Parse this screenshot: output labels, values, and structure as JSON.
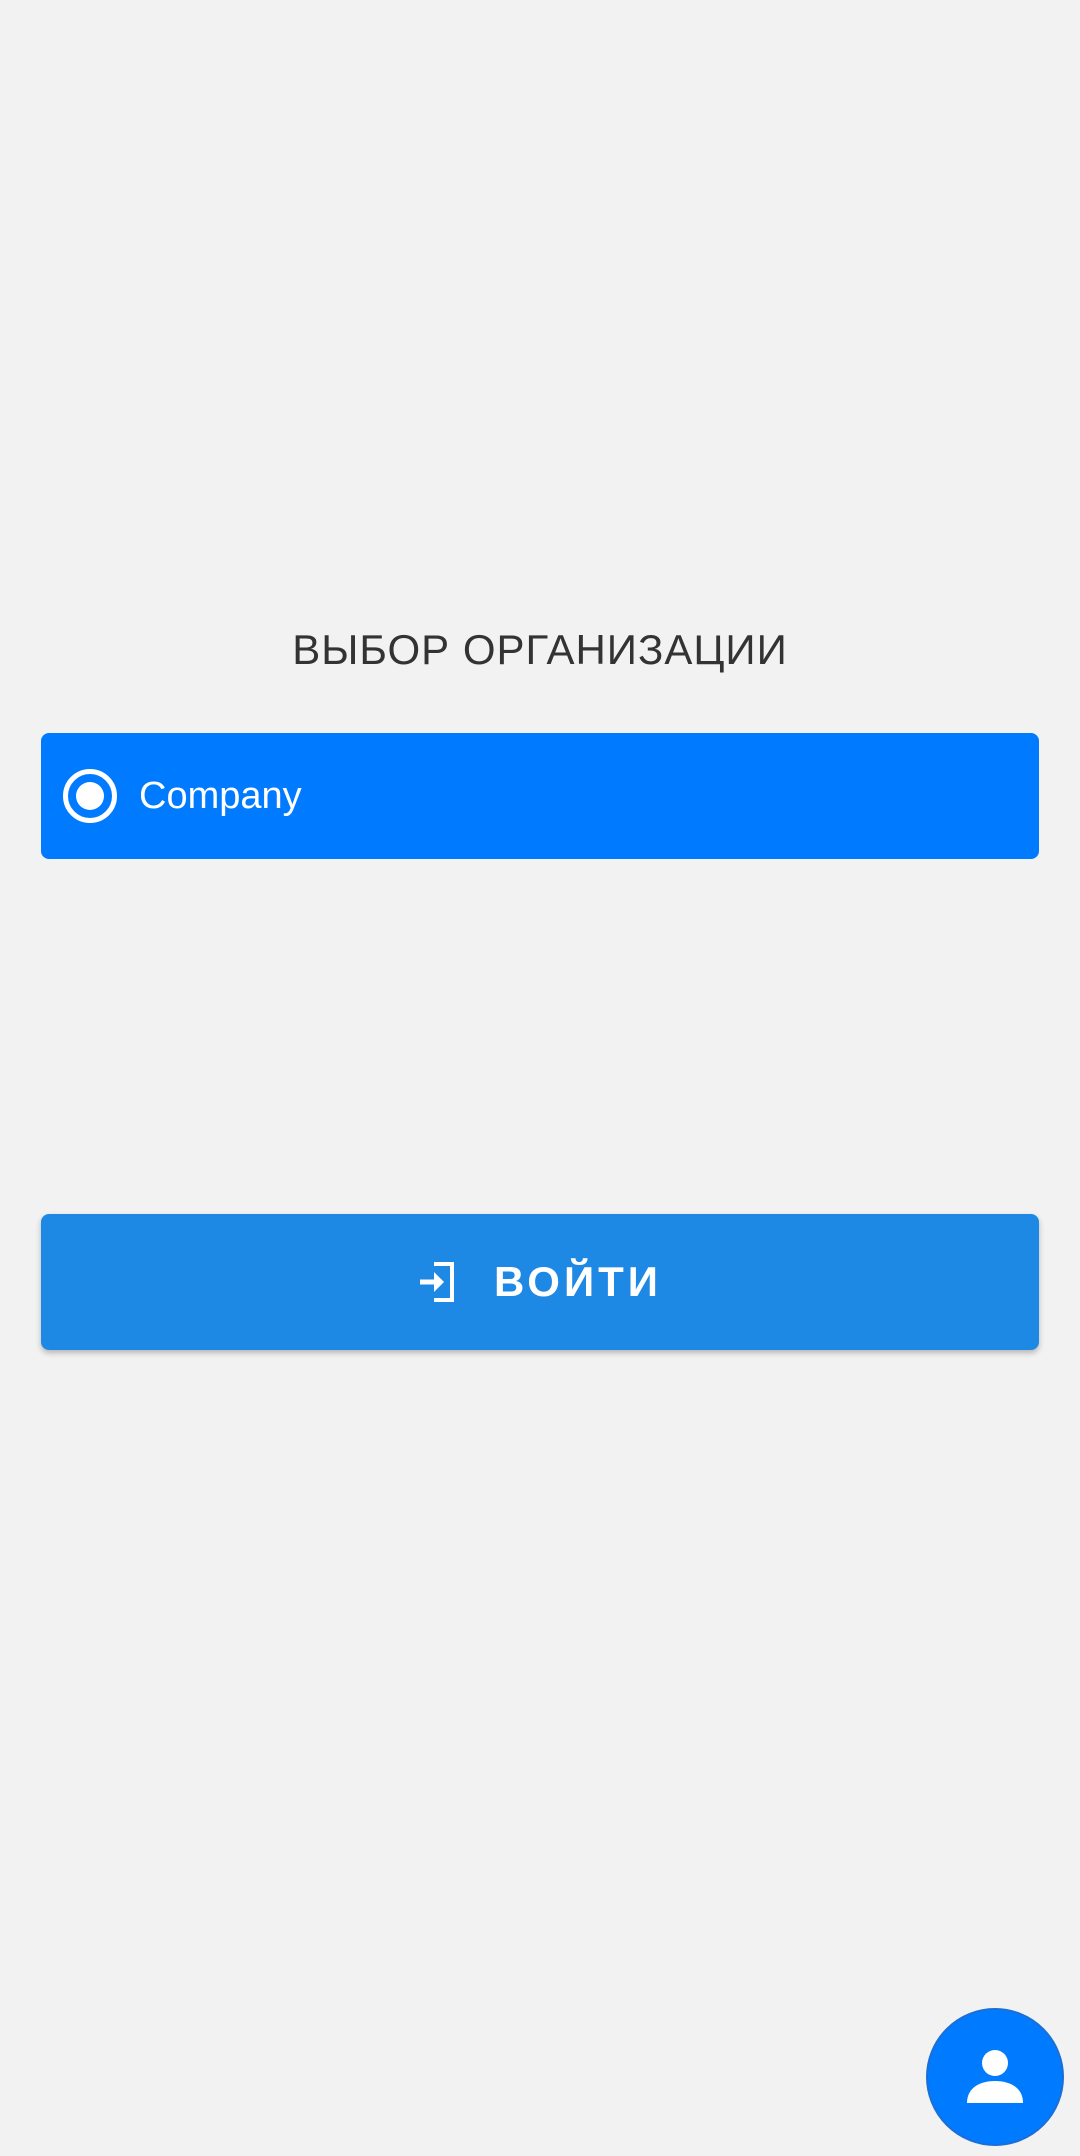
{
  "screen": {
    "title": "ВЫБОР ОРГАНИЗАЦИИ"
  },
  "organizations": [
    {
      "label": "Company",
      "selected": true
    }
  ],
  "login_button": {
    "label": "ВОЙТИ",
    "icon": "login-icon"
  },
  "fab": {
    "icon": "user-icon"
  },
  "colors": {
    "background": "#f2f2f2",
    "option_selected": "#007bff",
    "login_button": "#1e88e5",
    "fab": "#007bff",
    "title_text": "#333333"
  }
}
